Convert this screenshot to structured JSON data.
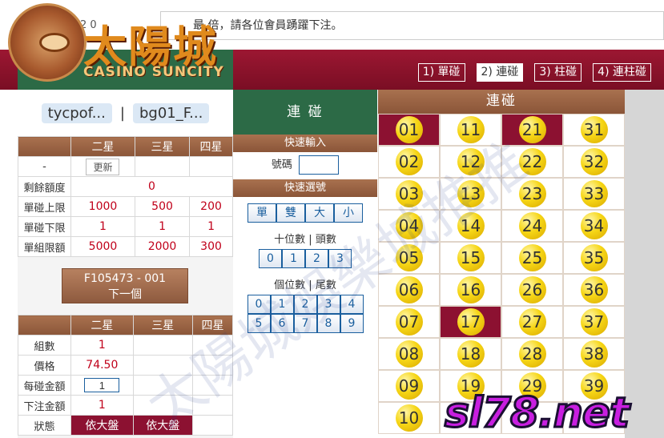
{
  "marquee": {
    "left_text": "2 0",
    "text": "最 倍，請各位會員踴躍下注。"
  },
  "logo": {
    "title": "太陽城",
    "subtitle": "CASINO SUNCITY"
  },
  "tabs": [
    {
      "label": "1) 單碰"
    },
    {
      "label": "2) 連碰"
    },
    {
      "label": "3) 柱碰"
    },
    {
      "label": "4) 連柱碰"
    }
  ],
  "users": {
    "user1": "tycpof...",
    "separator": "|",
    "user2": "bg01_F..."
  },
  "limits": {
    "headers": [
      "",
      "二星",
      "三星",
      "四星"
    ],
    "dash": "-",
    "refresh_label": "更新",
    "rows": [
      {
        "label": "剩餘額度",
        "values": [
          "0"
        ]
      },
      {
        "label": "單碰上限",
        "values": [
          "1000",
          "500",
          "200"
        ]
      },
      {
        "label": "單碰下限",
        "values": [
          "1",
          "1",
          "1"
        ]
      },
      {
        "label": "單組限額",
        "values": [
          "5000",
          "2000",
          "300"
        ]
      }
    ]
  },
  "next_button": {
    "line1": "F105473 - 001",
    "line2": "下一個"
  },
  "bet": {
    "headers": [
      "",
      "二星",
      "三星",
      "四星"
    ],
    "rows": [
      {
        "label": "組數",
        "value": "1"
      },
      {
        "label": "價格",
        "value": "74.50"
      },
      {
        "label": "每碰金額",
        "value": "1"
      },
      {
        "label": "下注金額",
        "value": "1"
      },
      {
        "label": "狀態",
        "status": [
          "依大盤",
          "依大盤"
        ]
      }
    ]
  },
  "mid": {
    "title": "連 碰",
    "quick_input": "快速輸入",
    "number_label": "號碼",
    "quick_select": "快速選號",
    "quick_buttons": [
      "單",
      "雙",
      "大",
      "小"
    ],
    "tens_label": "十位數 | 頭數",
    "tens": [
      "0",
      "1",
      "2",
      "3"
    ],
    "units_label": "個位數 | 尾數",
    "units": [
      "0",
      "1",
      "2",
      "3",
      "4",
      "5",
      "6",
      "7",
      "8",
      "9"
    ]
  },
  "balls": {
    "header": "連碰",
    "numbers": [
      "01",
      "11",
      "21",
      "31",
      "02",
      "12",
      "22",
      "32",
      "03",
      "13",
      "23",
      "33",
      "04",
      "14",
      "24",
      "34",
      "05",
      "15",
      "25",
      "35",
      "06",
      "16",
      "26",
      "36",
      "07",
      "17",
      "27",
      "37",
      "08",
      "18",
      "28",
      "38",
      "09",
      "19",
      "29",
      "39",
      "10",
      "",
      "",
      ""
    ],
    "selected": [
      "01",
      "21",
      "17"
    ]
  },
  "watermark": {
    "text": "太陽城娛樂城推推",
    "brand": "sl78.net"
  },
  "colors": {
    "header_red": "#9c1732",
    "green": "#2c6a46",
    "brown": "#a9714f",
    "selected": "#8c1131",
    "ball": "#f6d616"
  }
}
